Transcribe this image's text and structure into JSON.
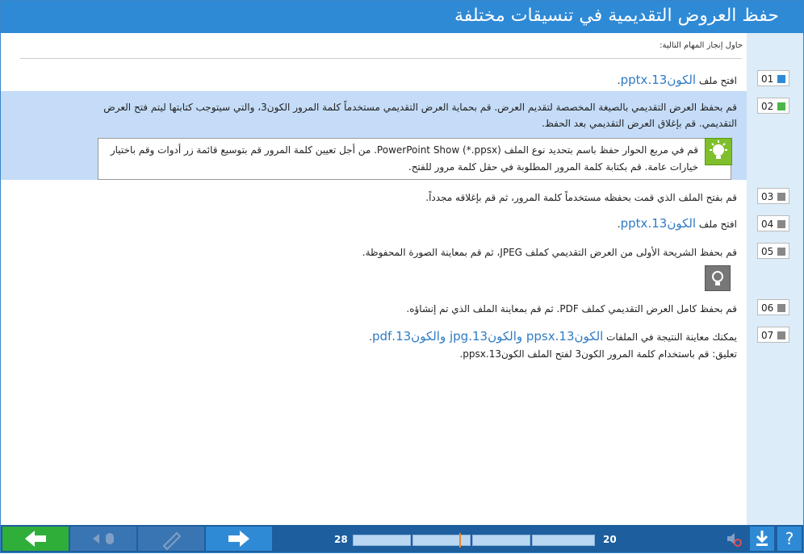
{
  "window": {
    "title": "حفظ العروض التقديمية في تنسيقات مختلفة"
  },
  "intro": "حاول إنجاز المهام التالية:",
  "tasks": [
    {
      "num": "01",
      "text": "افتح ملف ",
      "link": "الكون13.pptx",
      "after": "."
    },
    {
      "num": "02",
      "text": "قم بحفظ العرض التقديمي بالصيغة المخصصة لتقديم العرض. قم بحماية العرض التقديمي مستخدماً كلمة المرور الكون3، والتي سيتوجب كتابتها ليتم فتح العرض التقديمي. قم بإغلاق العرض التقديمي بعد الحفظ."
    },
    {
      "num": "03",
      "text": "قم بفتح الملف الذي قمت بحفظه مستخدماً كلمة المرور، ثم قم بإغلاقه مجدداً."
    },
    {
      "num": "04",
      "text": "افتح ملف ",
      "link": "الكون13.pptx",
      "after": "."
    },
    {
      "num": "05",
      "text": "قم بحفظ الشريحة الأولى من العرض التقديمي كملف JPEG، ثم قم بمعاينة الصورة المحفوظة."
    },
    {
      "num": "06",
      "text": "قم بحفظ كامل العرض التقديمي كملف PDF. ثم قم بمعاينة الملف الذي تم إنشاؤه."
    },
    {
      "num": "07",
      "text": "يمكنك معاينة النتيجة في الملفات ",
      "link": "الكون13.ppsx والكون13.jpg والكون13.pdf",
      "after": ".",
      "note": "تعليق: قم باستخدام كلمة المرور الكون3 لفتح الملف الكون13.ppsx."
    }
  ],
  "tip": {
    "text": "قم في مربع الحوار حفظ باسم بتحديد نوع الملف PowerPoint Show (*.ppsx). من أجل تعيين كلمة المرور قم بتوسيع قائمة زر أدوات وقم باختيار خيارات عامة. قم بكتابة كلمة المرور المطلوبة في حقل كلمة مرور للفتح."
  },
  "progress": {
    "left_label": "28",
    "right_label": "20",
    "fraction": 0.44
  },
  "colors": {
    "accent": "#2f8ad6",
    "highlight": "#c4dcf7",
    "green": "#2fae3a",
    "done_task": "#2f8ad6",
    "current_task": "#4cb748",
    "pending_task": "#888888"
  },
  "icons": [
    "back-arrow-icon",
    "mouse-pointer-icon",
    "pen-icon",
    "forward-arrow-icon",
    "mute-icon",
    "download-icon",
    "help-icon",
    "lightbulb-icon"
  ]
}
